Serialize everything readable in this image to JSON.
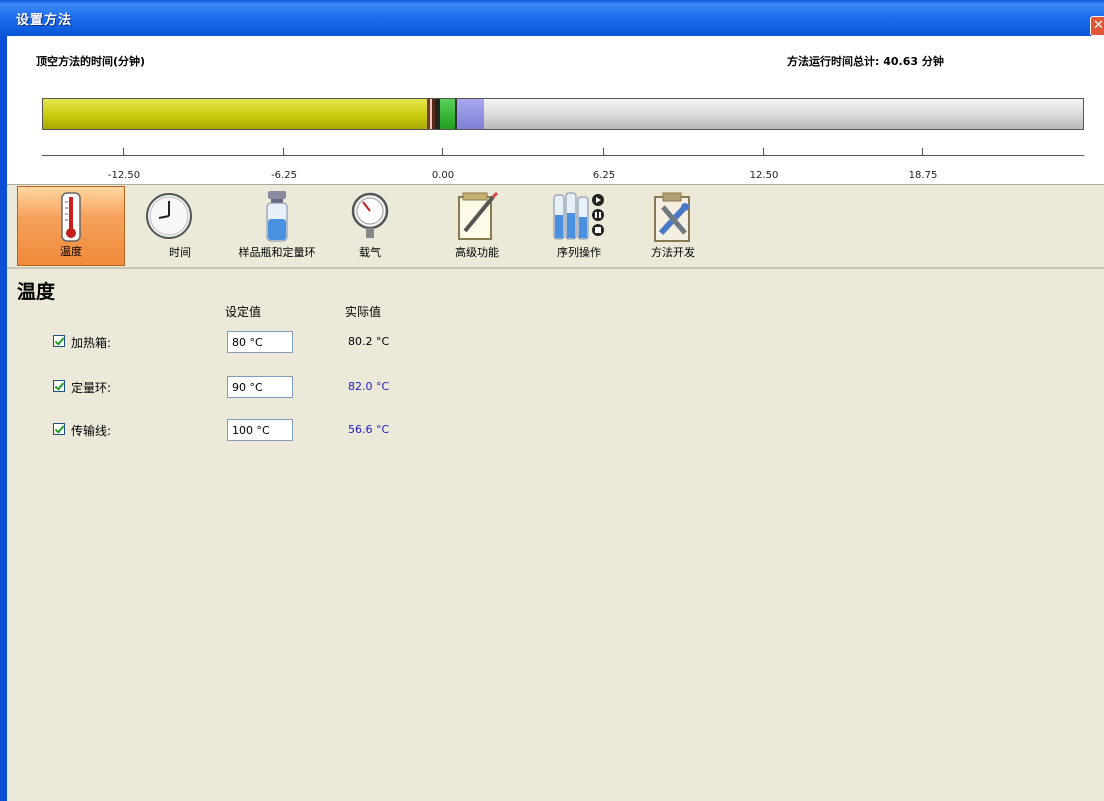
{
  "window": {
    "title": "设置方法"
  },
  "timeline": {
    "label": "顶空方法的时间(分钟)",
    "total": "方法运行时间总计: 40.63 分钟",
    "ticks": [
      "-12.50",
      "-6.25",
      "0.00",
      "6.25",
      "12.50",
      "18.75"
    ],
    "colors": {
      "yellow": "#c8c80a",
      "green": "#1ea01e",
      "violet": "#8080d8",
      "brown": "#7a3a28"
    }
  },
  "toolbar": {
    "items": [
      {
        "id": "temperature",
        "label": "温度",
        "icon": "thermometer-icon"
      },
      {
        "id": "time",
        "label": "时间",
        "icon": "clock-icon"
      },
      {
        "id": "vial",
        "label": "样品瓶和定量环",
        "icon": "vial-icon"
      },
      {
        "id": "carrier",
        "label": "载气",
        "icon": "gauge-icon"
      },
      {
        "id": "advanced",
        "label": "高级功能",
        "icon": "notepad-icon"
      },
      {
        "id": "sequence",
        "label": "序列操作",
        "icon": "sequence-icon"
      },
      {
        "id": "method-dev",
        "label": "方法开发",
        "icon": "tools-clipboard-icon"
      }
    ]
  },
  "temperature": {
    "title": "温度",
    "col_setpoint": "设定值",
    "col_actual": "实际值",
    "rows": [
      {
        "label": "加热箱:",
        "setpoint": "80 °C",
        "actual": "80.2 °C",
        "actual_color": "#000000"
      },
      {
        "label": "定量环:",
        "setpoint": "90 °C",
        "actual": "82.0 °C",
        "actual_color": "#1a1ad0"
      },
      {
        "label": "传输线:",
        "setpoint": "100 °C",
        "actual": "56.6 °C",
        "actual_color": "#1a1ad0"
      }
    ]
  }
}
